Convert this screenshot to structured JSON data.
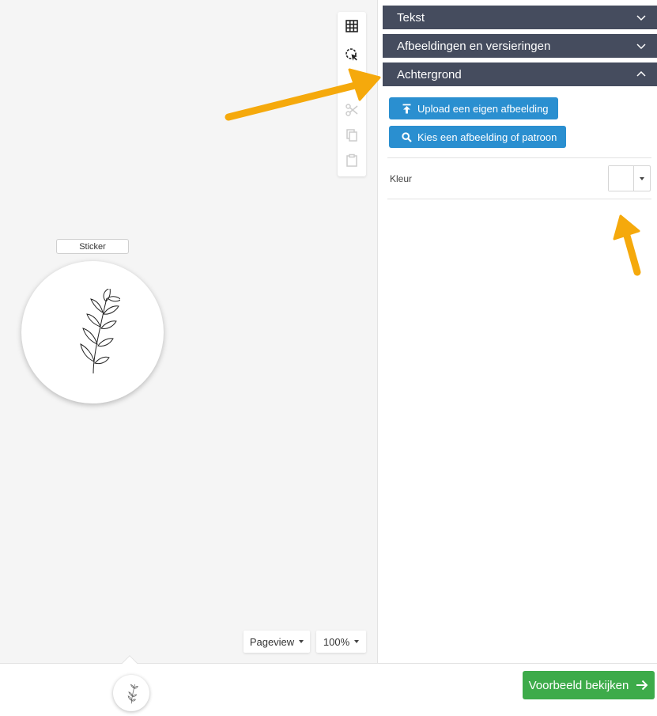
{
  "canvas": {
    "sticker_label": "Sticker",
    "pageview_label": "Pageview",
    "zoom_label": "100%"
  },
  "toolbar": {
    "tools": [
      "grid-icon",
      "select-icon",
      "scissors-icon",
      "copy-icon",
      "paste-icon"
    ]
  },
  "panel": {
    "sections": [
      {
        "label": "Tekst",
        "expanded": false
      },
      {
        "label": "Afbeeldingen en versieringen",
        "expanded": false
      },
      {
        "label": "Achtergrond",
        "expanded": true
      }
    ],
    "upload_button": "Upload een eigen afbeelding",
    "choose_button": "Kies een afbeelding of patroon",
    "color_label": "Kleur",
    "color_value": "#ffffff"
  },
  "footer": {
    "preview_button": "Voorbeeld bekijken"
  },
  "colors": {
    "header": "#454c5e",
    "primary": "#2a8fd0",
    "success": "#3dab4a",
    "annotation_arrow": "#f5a90c"
  }
}
